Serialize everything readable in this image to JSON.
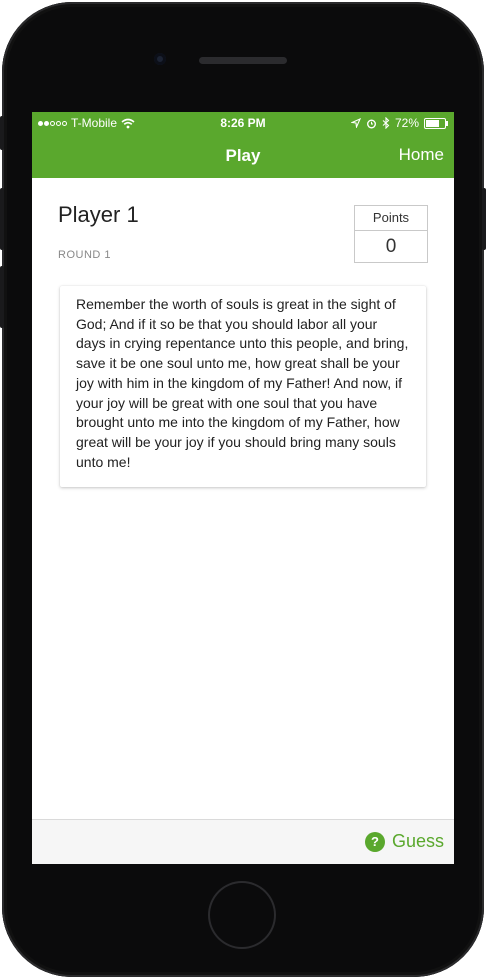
{
  "status_bar": {
    "carrier": "T-Mobile",
    "time": "8:26 PM",
    "battery": "72%",
    "battery_level": 0.72,
    "signal_bars_filled": 2,
    "signal_bars_total": 5,
    "icons": [
      "wifi-icon",
      "location-icon",
      "alarm-icon",
      "bluetooth-icon",
      "battery-icon"
    ]
  },
  "nav": {
    "title": "Play",
    "home_label": "Home"
  },
  "player": {
    "name": "Player 1",
    "round": "ROUND 1"
  },
  "points": {
    "label": "Points",
    "value": "0"
  },
  "verse": {
    "text": "Remember the worth of souls is great in the sight of God; And if it so be that you should labor all your days in crying repentance unto this people, and bring, save it be one soul unto me, how great shall be your joy with him in the kingdom of my Father! And now, if your joy will be great with one soul that you have brought unto me into the kingdom of my Father, how great will be your joy if you should bring many souls unto me!"
  },
  "bottom_bar": {
    "guess_label": "Guess",
    "guess_icon": "question-circle-icon",
    "guess_icon_glyph": "?"
  },
  "colors": {
    "accent": "#5aa82d",
    "text": "#222222"
  }
}
